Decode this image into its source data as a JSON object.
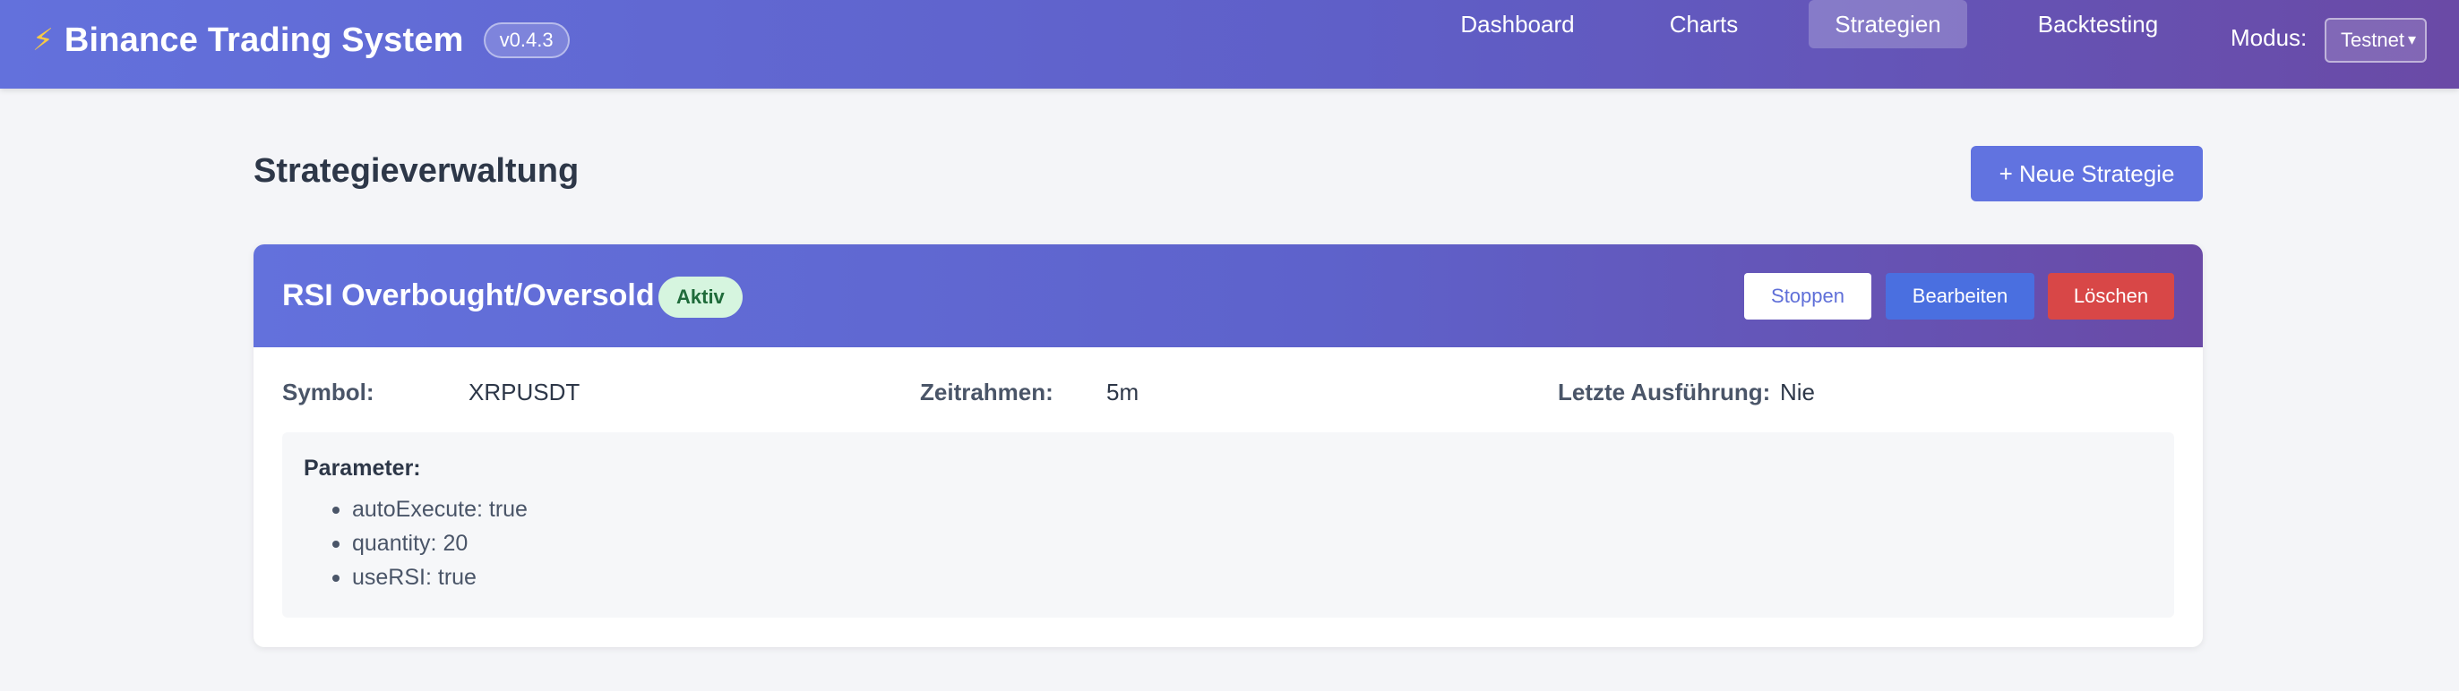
{
  "header": {
    "brand_icon": "lightning-icon",
    "title": "Binance Trading System",
    "version": "v0.4.3",
    "nav": [
      {
        "label": "Dashboard",
        "active": false
      },
      {
        "label": "Charts",
        "active": false
      },
      {
        "label": "Strategien",
        "active": true
      },
      {
        "label": "Backtesting",
        "active": false
      }
    ],
    "mode_label": "Modus:",
    "mode_value": "Testnet"
  },
  "page": {
    "title": "Strategieverwaltung",
    "new_button": "+ Neue Strategie"
  },
  "strategy": {
    "name": "RSI Overbought/Oversold",
    "status": "Aktiv",
    "actions": {
      "stop": "Stoppen",
      "edit": "Bearbeiten",
      "delete": "Löschen"
    },
    "fields": {
      "symbol_label": "Symbol:",
      "symbol_value": "XRPUSDT",
      "timeframe_label": "Zeitrahmen:",
      "timeframe_value": "5m",
      "last_run_label": "Letzte Ausführung:",
      "last_run_value": "Nie"
    },
    "params_title": "Parameter:",
    "params": [
      "autoExecute: true",
      "quantity: 20",
      "useRSI: true"
    ]
  },
  "colors": {
    "header_gradient_start": "#6371dc",
    "header_gradient_end": "#6a4aa6",
    "primary": "#6173e0",
    "edit": "#4a6fe0",
    "danger": "#d84747",
    "status_bg": "#d6f5df",
    "status_text": "#1f6b3a"
  }
}
